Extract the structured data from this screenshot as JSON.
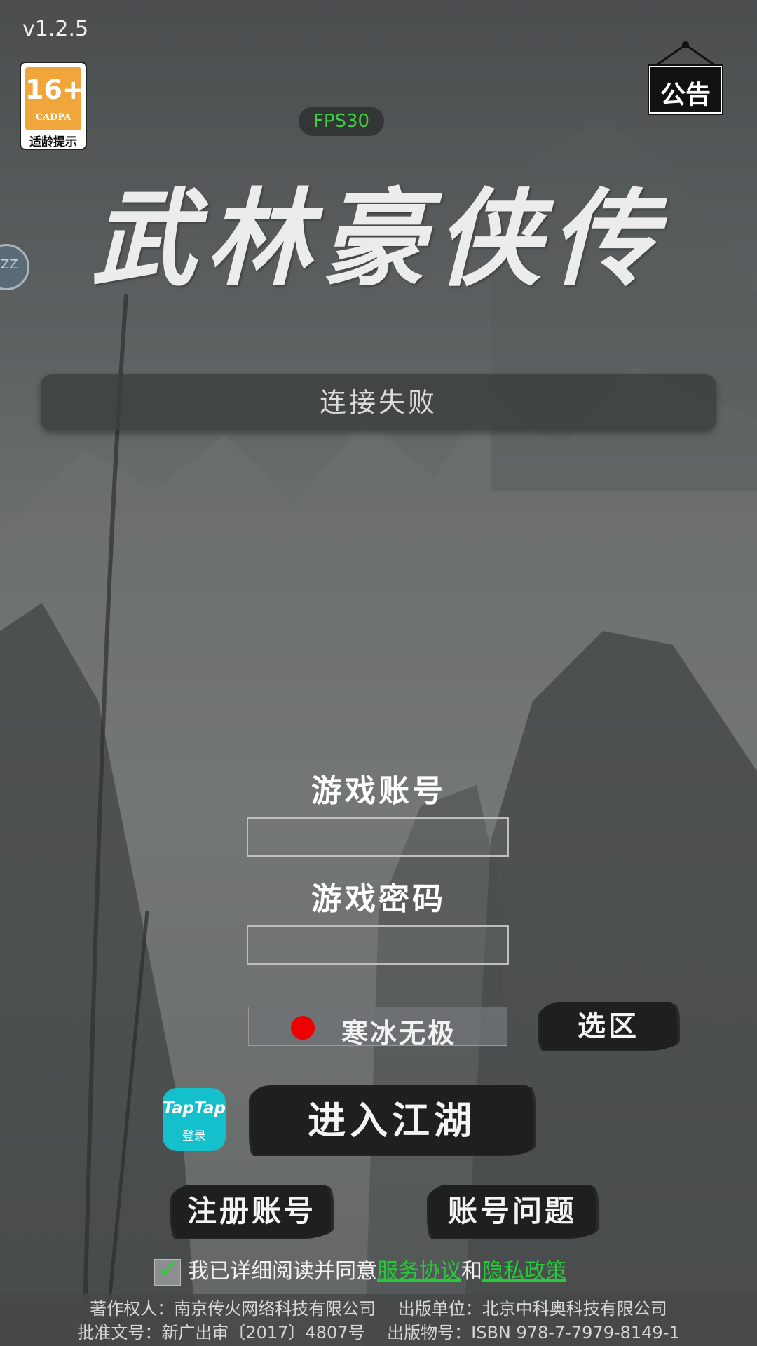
{
  "app": {
    "version": "v1.2.5",
    "fps": "FPS30",
    "title": "武林豪侠传",
    "status": "连接失败"
  },
  "age_badge": {
    "rating": "16+",
    "org": "CADPA",
    "tip": "适龄提示"
  },
  "notice_button": {
    "label": "公告"
  },
  "side_widget": {
    "text": "ZZ"
  },
  "login": {
    "account_label": "游戏账号",
    "account_value": "",
    "password_label": "游戏密码",
    "password_value": ""
  },
  "server": {
    "name": "寒冰无极",
    "status_color": "#e00000",
    "select_label": "选区"
  },
  "taptap": {
    "brand": "TapTap",
    "label": "登录"
  },
  "buttons": {
    "enter": "进入江湖",
    "register": "注册账号",
    "account_issue": "账号问题"
  },
  "agreement": {
    "checked": true,
    "text": "我已详细阅读并同意",
    "service_link": "服务协议",
    "and": "和",
    "privacy_link": "隐私政策"
  },
  "footer": {
    "line1": "著作权人：南京传火网络科技有限公司　 出版单位：北京中科奥科技有限公司",
    "line2": "批准文号：新广出审〔2017〕4807号　 出版物号：ISBN 978-7-7979-8149-1"
  },
  "colors": {
    "accent_green": "#27c93a",
    "fps_green": "#3ecf3e",
    "taptap": "#14c0cc"
  }
}
